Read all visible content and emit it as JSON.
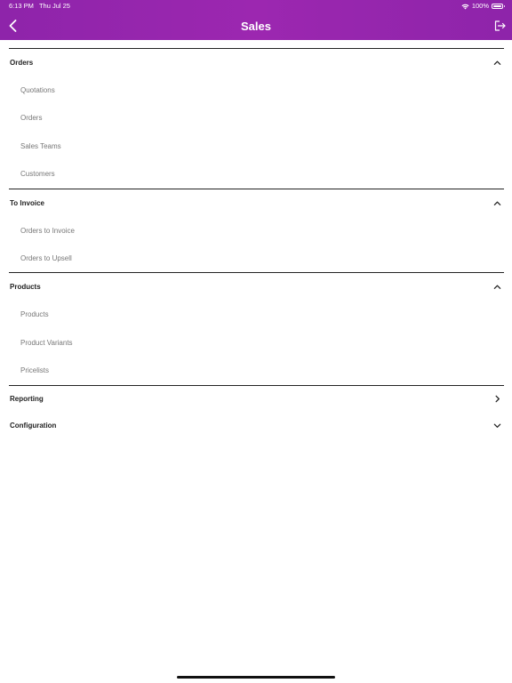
{
  "status_bar": {
    "time": "6:13 PM",
    "date": "Thu Jul 25",
    "battery": "100%"
  },
  "header": {
    "title": "Sales"
  },
  "menu": {
    "sections": [
      {
        "label": "Orders",
        "expanded": true,
        "items": [
          {
            "label": "Quotations"
          },
          {
            "label": "Orders"
          },
          {
            "label": "Sales Teams"
          },
          {
            "label": "Customers"
          }
        ]
      },
      {
        "label": "To Invoice",
        "expanded": true,
        "items": [
          {
            "label": "Orders to Invoice"
          },
          {
            "label": "Orders to Upsell"
          }
        ]
      },
      {
        "label": "Products",
        "expanded": true,
        "items": [
          {
            "label": "Products"
          },
          {
            "label": "Product Variants"
          },
          {
            "label": "Pricelists"
          }
        ]
      },
      {
        "label": "Reporting",
        "expanded": false,
        "indicator": "chevron-right-icon"
      },
      {
        "label": "Configuration",
        "expanded": false,
        "indicator": "chevron-down-icon"
      }
    ]
  },
  "colors": {
    "header_bg": "#9c27b0",
    "header_text": "#ffffff",
    "sub_item_text": "#777777",
    "divider": "#222222"
  }
}
